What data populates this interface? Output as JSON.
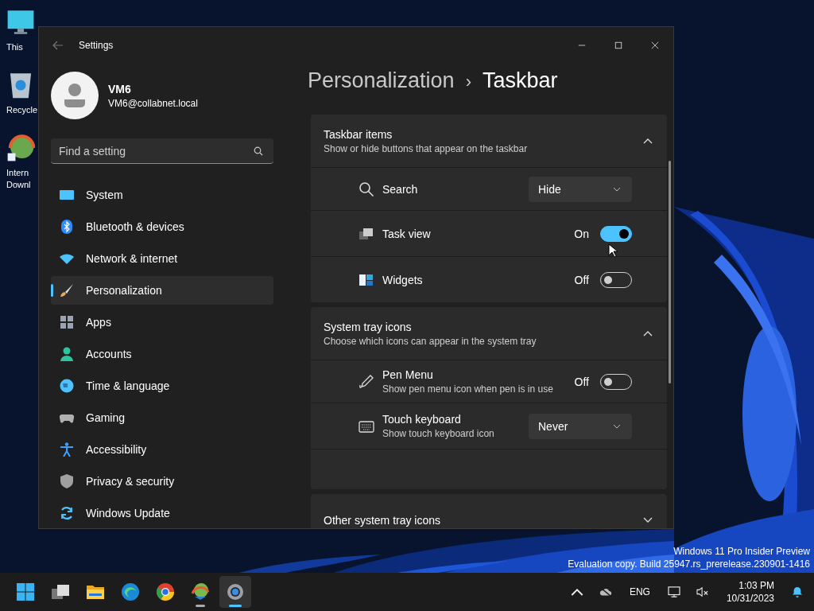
{
  "desktop": {
    "icons": [
      {
        "kind": "monitor",
        "label": "This"
      },
      {
        "kind": "recycle",
        "label": "Recycle"
      },
      {
        "kind": "download",
        "label": "Intern\nDownl"
      }
    ],
    "watermark": [
      "Windows 11 Pro Insider Preview",
      "Evaluation copy. Build 25947.rs_prerelease.230901-1416"
    ]
  },
  "window": {
    "title": "Settings"
  },
  "account": {
    "name": "VM6",
    "email": "VM6@collabnet.local"
  },
  "search": {
    "placeholder": "Find a setting"
  },
  "sidebar": {
    "items": [
      {
        "kind": "system",
        "label": "System",
        "selected": false
      },
      {
        "kind": "bluetooth",
        "label": "Bluetooth & devices",
        "selected": false
      },
      {
        "kind": "network",
        "label": "Network & internet",
        "selected": false
      },
      {
        "kind": "personalization",
        "label": "Personalization",
        "selected": true
      },
      {
        "kind": "apps",
        "label": "Apps",
        "selected": false
      },
      {
        "kind": "accounts",
        "label": "Accounts",
        "selected": false
      },
      {
        "kind": "time",
        "label": "Time & language",
        "selected": false
      },
      {
        "kind": "gaming",
        "label": "Gaming",
        "selected": false
      },
      {
        "kind": "accessibility",
        "label": "Accessibility",
        "selected": false
      },
      {
        "kind": "privacy",
        "label": "Privacy & security",
        "selected": false
      },
      {
        "kind": "update",
        "label": "Windows Update",
        "selected": false
      }
    ]
  },
  "breadcrumb": {
    "parent": "Personalization",
    "separator": "›",
    "current": "Taskbar"
  },
  "sections": [
    {
      "title": "Taskbar items",
      "subtitle": "Show or hide buttons that appear on the taskbar",
      "expanded": true,
      "items": [
        {
          "kind": "dropdown",
          "label": "Search",
          "value": "Hide"
        },
        {
          "kind": "toggle",
          "label": "Task view",
          "on": true,
          "state_label": "On"
        },
        {
          "kind": "toggle",
          "label": "Widgets",
          "on": false,
          "state_label": "Off"
        }
      ]
    },
    {
      "title": "System tray icons",
      "subtitle": "Choose which icons can appear in the system tray",
      "expanded": true,
      "items": [
        {
          "kind": "toggle",
          "label": "Pen Menu",
          "description": "Show pen menu icon when pen is in use",
          "on": false,
          "state_label": "Off"
        },
        {
          "kind": "dropdown",
          "label": "Touch keyboard",
          "description": "Show touch keyboard icon",
          "value": "Never"
        }
      ]
    },
    {
      "title": "Other system tray icons",
      "expanded": false
    }
  ],
  "taskbar": {
    "apps": [
      {
        "kind": "start",
        "running": false,
        "selected": false
      },
      {
        "kind": "taskview",
        "running": false,
        "selected": false
      },
      {
        "kind": "explorer",
        "running": false,
        "selected": false
      },
      {
        "kind": "edge",
        "running": false,
        "selected": false
      },
      {
        "kind": "chrome",
        "running": false,
        "selected": false
      },
      {
        "kind": "idm",
        "running": true,
        "selected": false
      },
      {
        "kind": "settings",
        "running": true,
        "selected": true
      }
    ],
    "language": "ENG",
    "time": "1:03 PM",
    "date": "10/31/2023"
  }
}
